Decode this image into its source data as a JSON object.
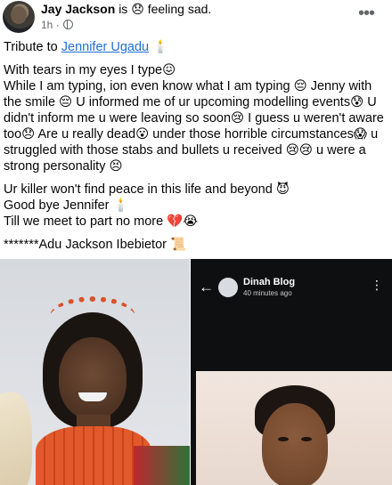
{
  "header": {
    "author_name": "Jay Jackson",
    "is_text": "is",
    "feeling_emoji": "😞",
    "feeling_text": "feeling sad.",
    "time": "1h ·",
    "audience_icon": "globe-icon",
    "more_icon": "more-horizontal-icon"
  },
  "body": {
    "tribute_prefix": "Tribute to",
    "tribute_link": "Jennifer Ugadu",
    "tribute_emoji": "🕯️",
    "para1": "With tears in my eyes I type😖\nWhile I am typing, ion even know what I am typing 😔 Jenny with the smile 😔 U informed me of ur upcoming modelling events😰 U didn't inform me u were leaving so soon😢 I guess u weren't aware too😞 Are u really dead😮 under those horrible circumstances😱 u struggled with those stabs and bullets u received 😢😢 u were a strong personality 😣",
    "para2_line1": "Ur killer won't find peace in this life and beyond 😈",
    "para2_line2": "Good bye Jennifer 🕯️",
    "para2_line3": "Till we meet to part no more 💔😭",
    "signature": "*******Adu Jackson Ibebietor 📜"
  },
  "photos": {
    "right": {
      "back_icon": "arrow-left-icon",
      "name": "Dinah Blog",
      "time": "40 minutes ago",
      "more_icon": "more-vertical-icon"
    }
  },
  "colors": {
    "link": "#216fdb",
    "meta": "#65676b",
    "text": "#050505"
  }
}
